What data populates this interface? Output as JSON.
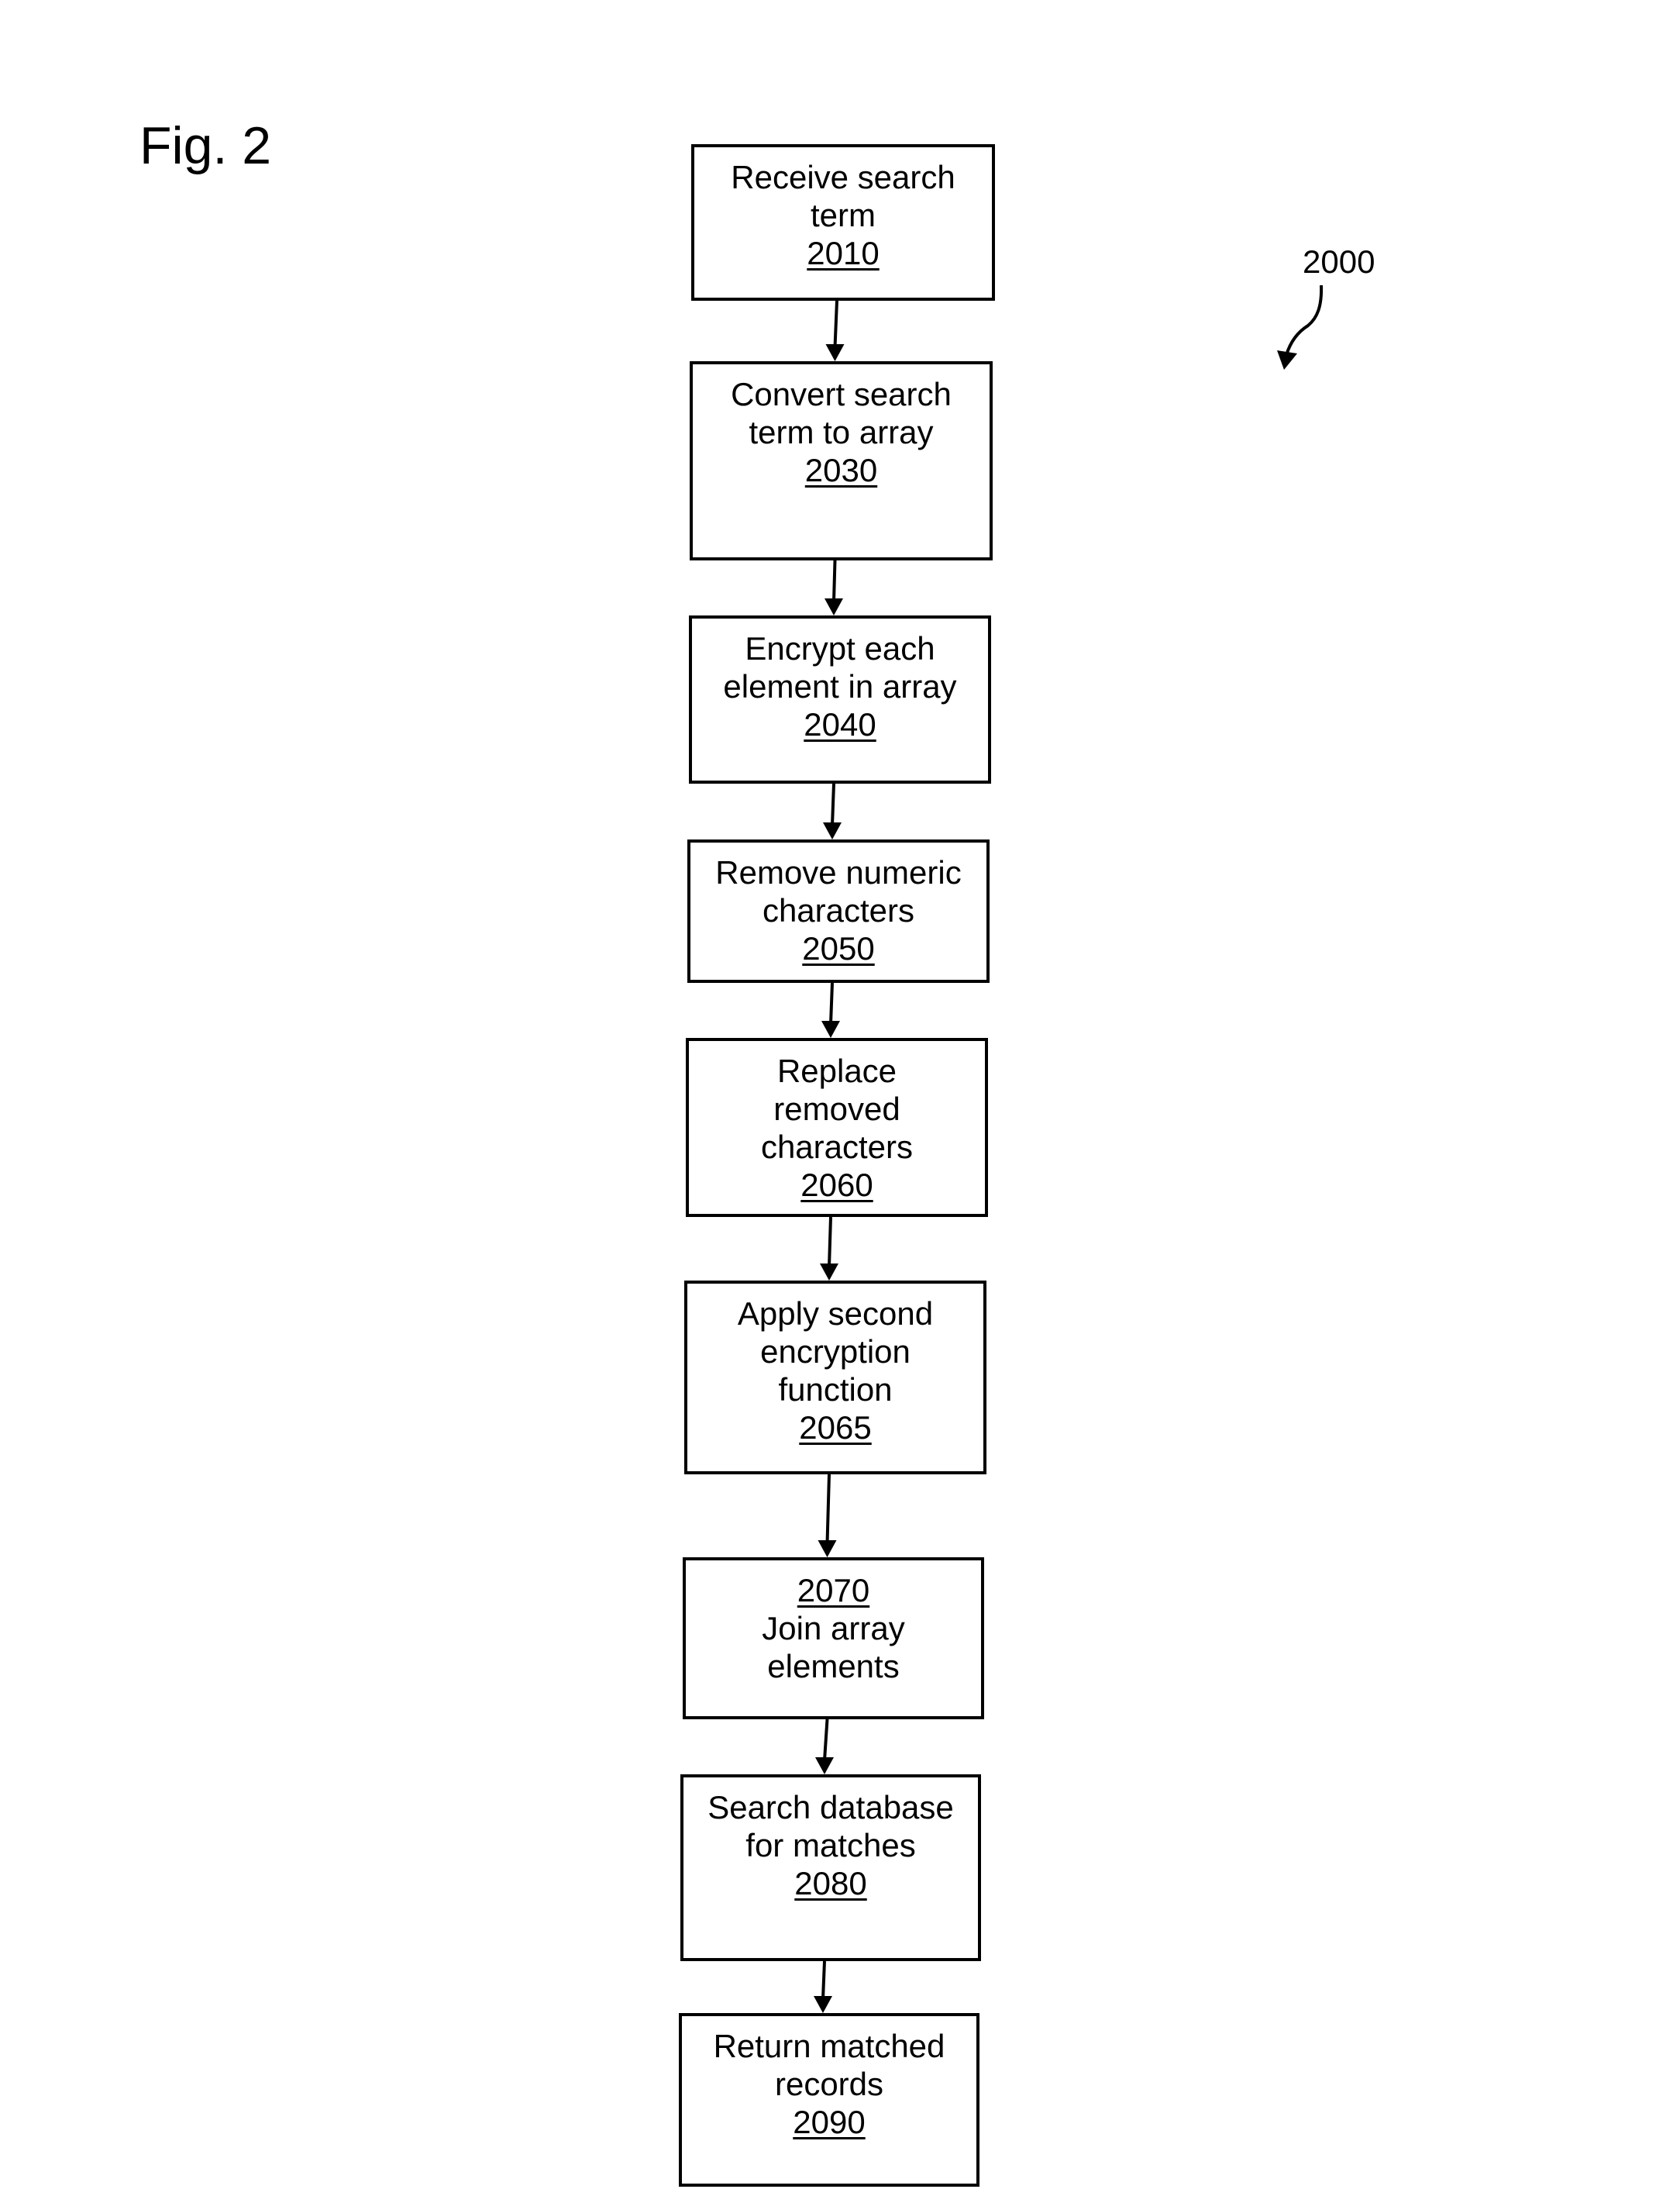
{
  "figure": {
    "label": "Fig. 2",
    "reference_numeral": "2000"
  },
  "steps": [
    {
      "id": "2010",
      "lines": [
        "Receive search",
        "term"
      ],
      "number": "2010",
      "number_first": false
    },
    {
      "id": "2030",
      "lines": [
        "Convert search",
        "term to array"
      ],
      "number": "2030",
      "number_first": false
    },
    {
      "id": "2040",
      "lines": [
        "Encrypt each",
        "element in array"
      ],
      "number": "2040",
      "number_first": false
    },
    {
      "id": "2050",
      "lines": [
        "Remove numeric",
        "characters"
      ],
      "number": "2050",
      "number_first": false
    },
    {
      "id": "2060",
      "lines": [
        "Replace",
        "removed",
        "characters"
      ],
      "number": "2060",
      "number_first": false
    },
    {
      "id": "2065",
      "lines": [
        "Apply second",
        "encryption",
        "function"
      ],
      "number": "2065",
      "number_first": false
    },
    {
      "id": "2070",
      "lines": [
        "Join array",
        "elements"
      ],
      "number": "2070",
      "number_first": true
    },
    {
      "id": "2080",
      "lines": [
        "Search database",
        "for matches"
      ],
      "number": "2080",
      "number_first": false
    },
    {
      "id": "2090",
      "lines": [
        "Return matched",
        "records"
      ],
      "number": "2090",
      "number_first": false
    }
  ],
  "connections": [
    [
      "2010",
      "2030"
    ],
    [
      "2030",
      "2040"
    ],
    [
      "2040",
      "2050"
    ],
    [
      "2050",
      "2060"
    ],
    [
      "2060",
      "2065"
    ],
    [
      "2065",
      "2070"
    ],
    [
      "2070",
      "2080"
    ],
    [
      "2080",
      "2090"
    ]
  ]
}
